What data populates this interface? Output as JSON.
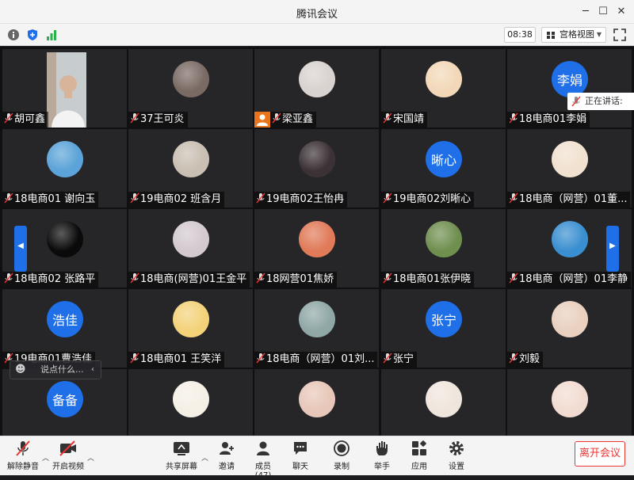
{
  "window": {
    "title": "腾讯会议"
  },
  "toolbar": {
    "timer": "08:38",
    "view_label": "宫格视图"
  },
  "speaking_label": "正在讲话:",
  "chat": {
    "placeholder": "说点什么..."
  },
  "participants": [
    {
      "name": "胡可鑫",
      "avatar": "photo"
    },
    {
      "name": "37王可炎",
      "avatar": "img",
      "color": "#7a6a64"
    },
    {
      "name": "梁亚鑫",
      "avatar": "img",
      "color": "#d9d2cf"
    },
    {
      "name": "宋国靖",
      "avatar": "img",
      "color": "#f2d8b8"
    },
    {
      "name": "18电商01李娟",
      "avatar": "text",
      "text": "李娟"
    },
    {
      "name": "18电商01 谢向玉",
      "avatar": "img",
      "color": "#5ba3d8"
    },
    {
      "name": "19电商02 班含月",
      "avatar": "img",
      "color": "#c9bfb2"
    },
    {
      "name": "19电商02王怡冉",
      "avatar": "img",
      "color": "#3c3236"
    },
    {
      "name": "19电商02刘晰心",
      "avatar": "text",
      "text": "晰心"
    },
    {
      "name": "18电商（网营）01董...",
      "avatar": "img",
      "color": "#f1e1cf"
    },
    {
      "name": "18电商02 张路平",
      "avatar": "img",
      "color": "#0a0a0a"
    },
    {
      "name": "18电商(网营)01王金平",
      "avatar": "img",
      "color": "#d3c9cf"
    },
    {
      "name": "18网营01焦娇",
      "avatar": "img",
      "color": "#e07a58"
    },
    {
      "name": "18电商01张伊晓",
      "avatar": "img",
      "color": "#6f8f4f"
    },
    {
      "name": "18电商（网营）01李静",
      "avatar": "img",
      "color": "#3a8fd0"
    },
    {
      "name": "19电商01曹浩佳",
      "avatar": "text",
      "text": "浩佳"
    },
    {
      "name": "18电商01 王笑洋",
      "avatar": "img",
      "color": "#f3d27a"
    },
    {
      "name": "18电商（网营）01刘...",
      "avatar": "img",
      "color": "#8fa7a6"
    },
    {
      "name": "张宁",
      "avatar": "text",
      "text": "张宁"
    },
    {
      "name": "刘毅",
      "avatar": "img",
      "color": "#e9d0bf"
    },
    {
      "name": "",
      "avatar": "text",
      "text": "备备"
    },
    {
      "name": "",
      "avatar": "img",
      "color": "#f5f0e6"
    },
    {
      "name": "",
      "avatar": "img",
      "color": "#e7c7b9"
    },
    {
      "name": "",
      "avatar": "img",
      "color": "#efe5dc"
    },
    {
      "name": "",
      "avatar": "img",
      "color": "#f2dcd2"
    }
  ],
  "bottom": {
    "unmute": "解除静音",
    "video": "开启视频",
    "share": "共享屏幕",
    "invite": "邀请",
    "members": "成员(47)",
    "chat": "聊天",
    "record": "录制",
    "raise": "举手",
    "apps": "应用",
    "settings": "设置",
    "leave": "离开会议"
  },
  "colors": {
    "accent": "#1e6fe8",
    "leave": "#e33333",
    "speaker_badge": "#e9741c"
  }
}
